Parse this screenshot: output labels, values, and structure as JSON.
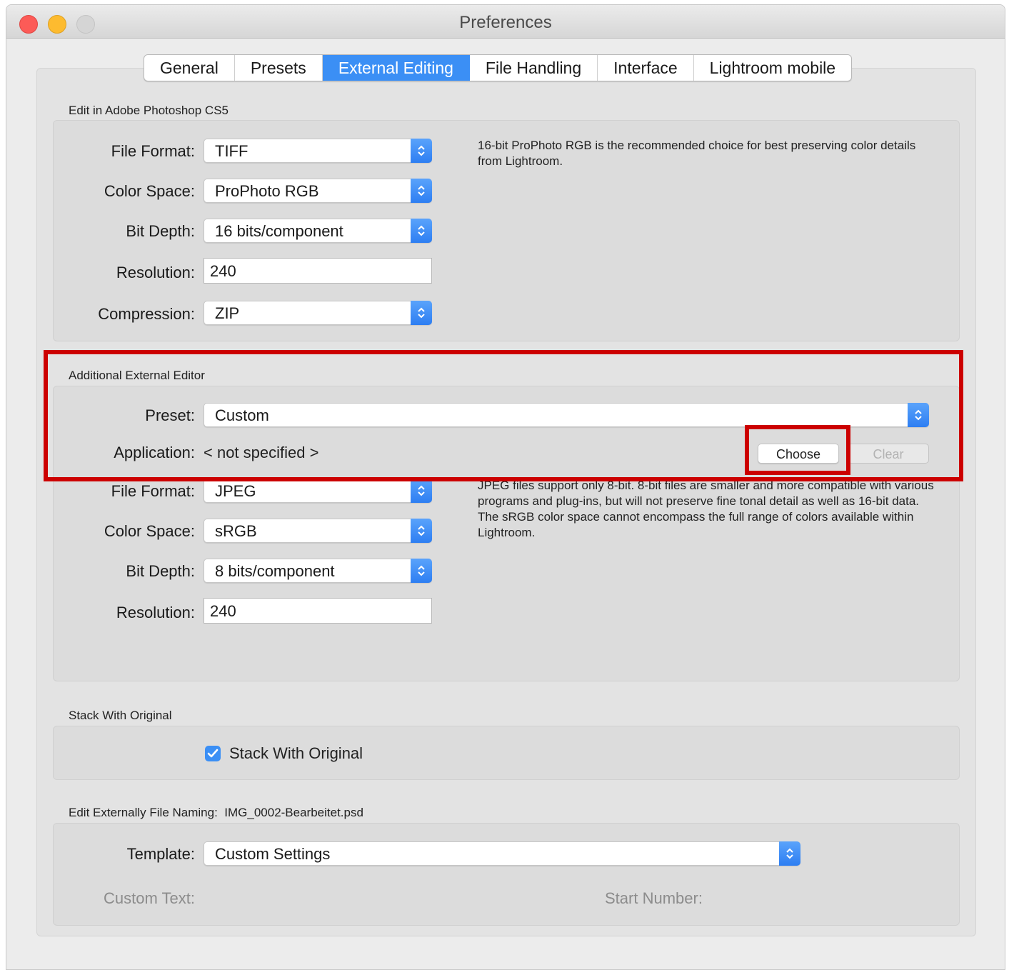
{
  "window": {
    "title": "Preferences"
  },
  "tabs": [
    {
      "label": "General"
    },
    {
      "label": "Presets"
    },
    {
      "label": "External Editing"
    },
    {
      "label": "File Handling"
    },
    {
      "label": "Interface"
    },
    {
      "label": "Lightroom mobile"
    }
  ],
  "active_tab": "External Editing",
  "photoshop": {
    "heading": "Edit in Adobe Photoshop CS5",
    "file_format_label": "File Format:",
    "file_format": "TIFF",
    "color_space_label": "Color Space:",
    "color_space": "ProPhoto RGB",
    "bit_depth_label": "Bit Depth:",
    "bit_depth": "16 bits/component",
    "resolution_label": "Resolution:",
    "resolution": "240",
    "compression_label": "Compression:",
    "compression": "ZIP",
    "note": "16-bit ProPhoto RGB is the recommended choice for best preserving color details from Lightroom."
  },
  "additional": {
    "heading": "Additional External Editor",
    "preset_label": "Preset:",
    "preset": "Custom",
    "application_label": "Application:",
    "application": "< not specified >",
    "choose_label": "Choose",
    "clear_label": "Clear",
    "file_format_label": "File Format:",
    "file_format": "JPEG",
    "color_space_label": "Color Space:",
    "color_space": "sRGB",
    "bit_depth_label": "Bit Depth:",
    "bit_depth": "8 bits/component",
    "resolution_label": "Resolution:",
    "resolution": "240",
    "note": "JPEG files support only 8-bit. 8-bit files are smaller and more compatible with various programs and plug-ins, but will not preserve fine tonal detail as well as 16-bit data. The sRGB color space cannot encompass the full range of colors available within Lightroom."
  },
  "stack": {
    "heading": "Stack With Original",
    "checkbox_label": "Stack With Original",
    "checked": true
  },
  "naming": {
    "heading": "Edit Externally File Naming:",
    "example": "IMG_0002-Bearbeitet.psd",
    "template_label": "Template:",
    "template": "Custom Settings",
    "custom_text_label": "Custom Text:",
    "start_number_label": "Start Number:"
  },
  "colors": {
    "accent": "#3b8ff5",
    "highlight": "#cc0000"
  }
}
